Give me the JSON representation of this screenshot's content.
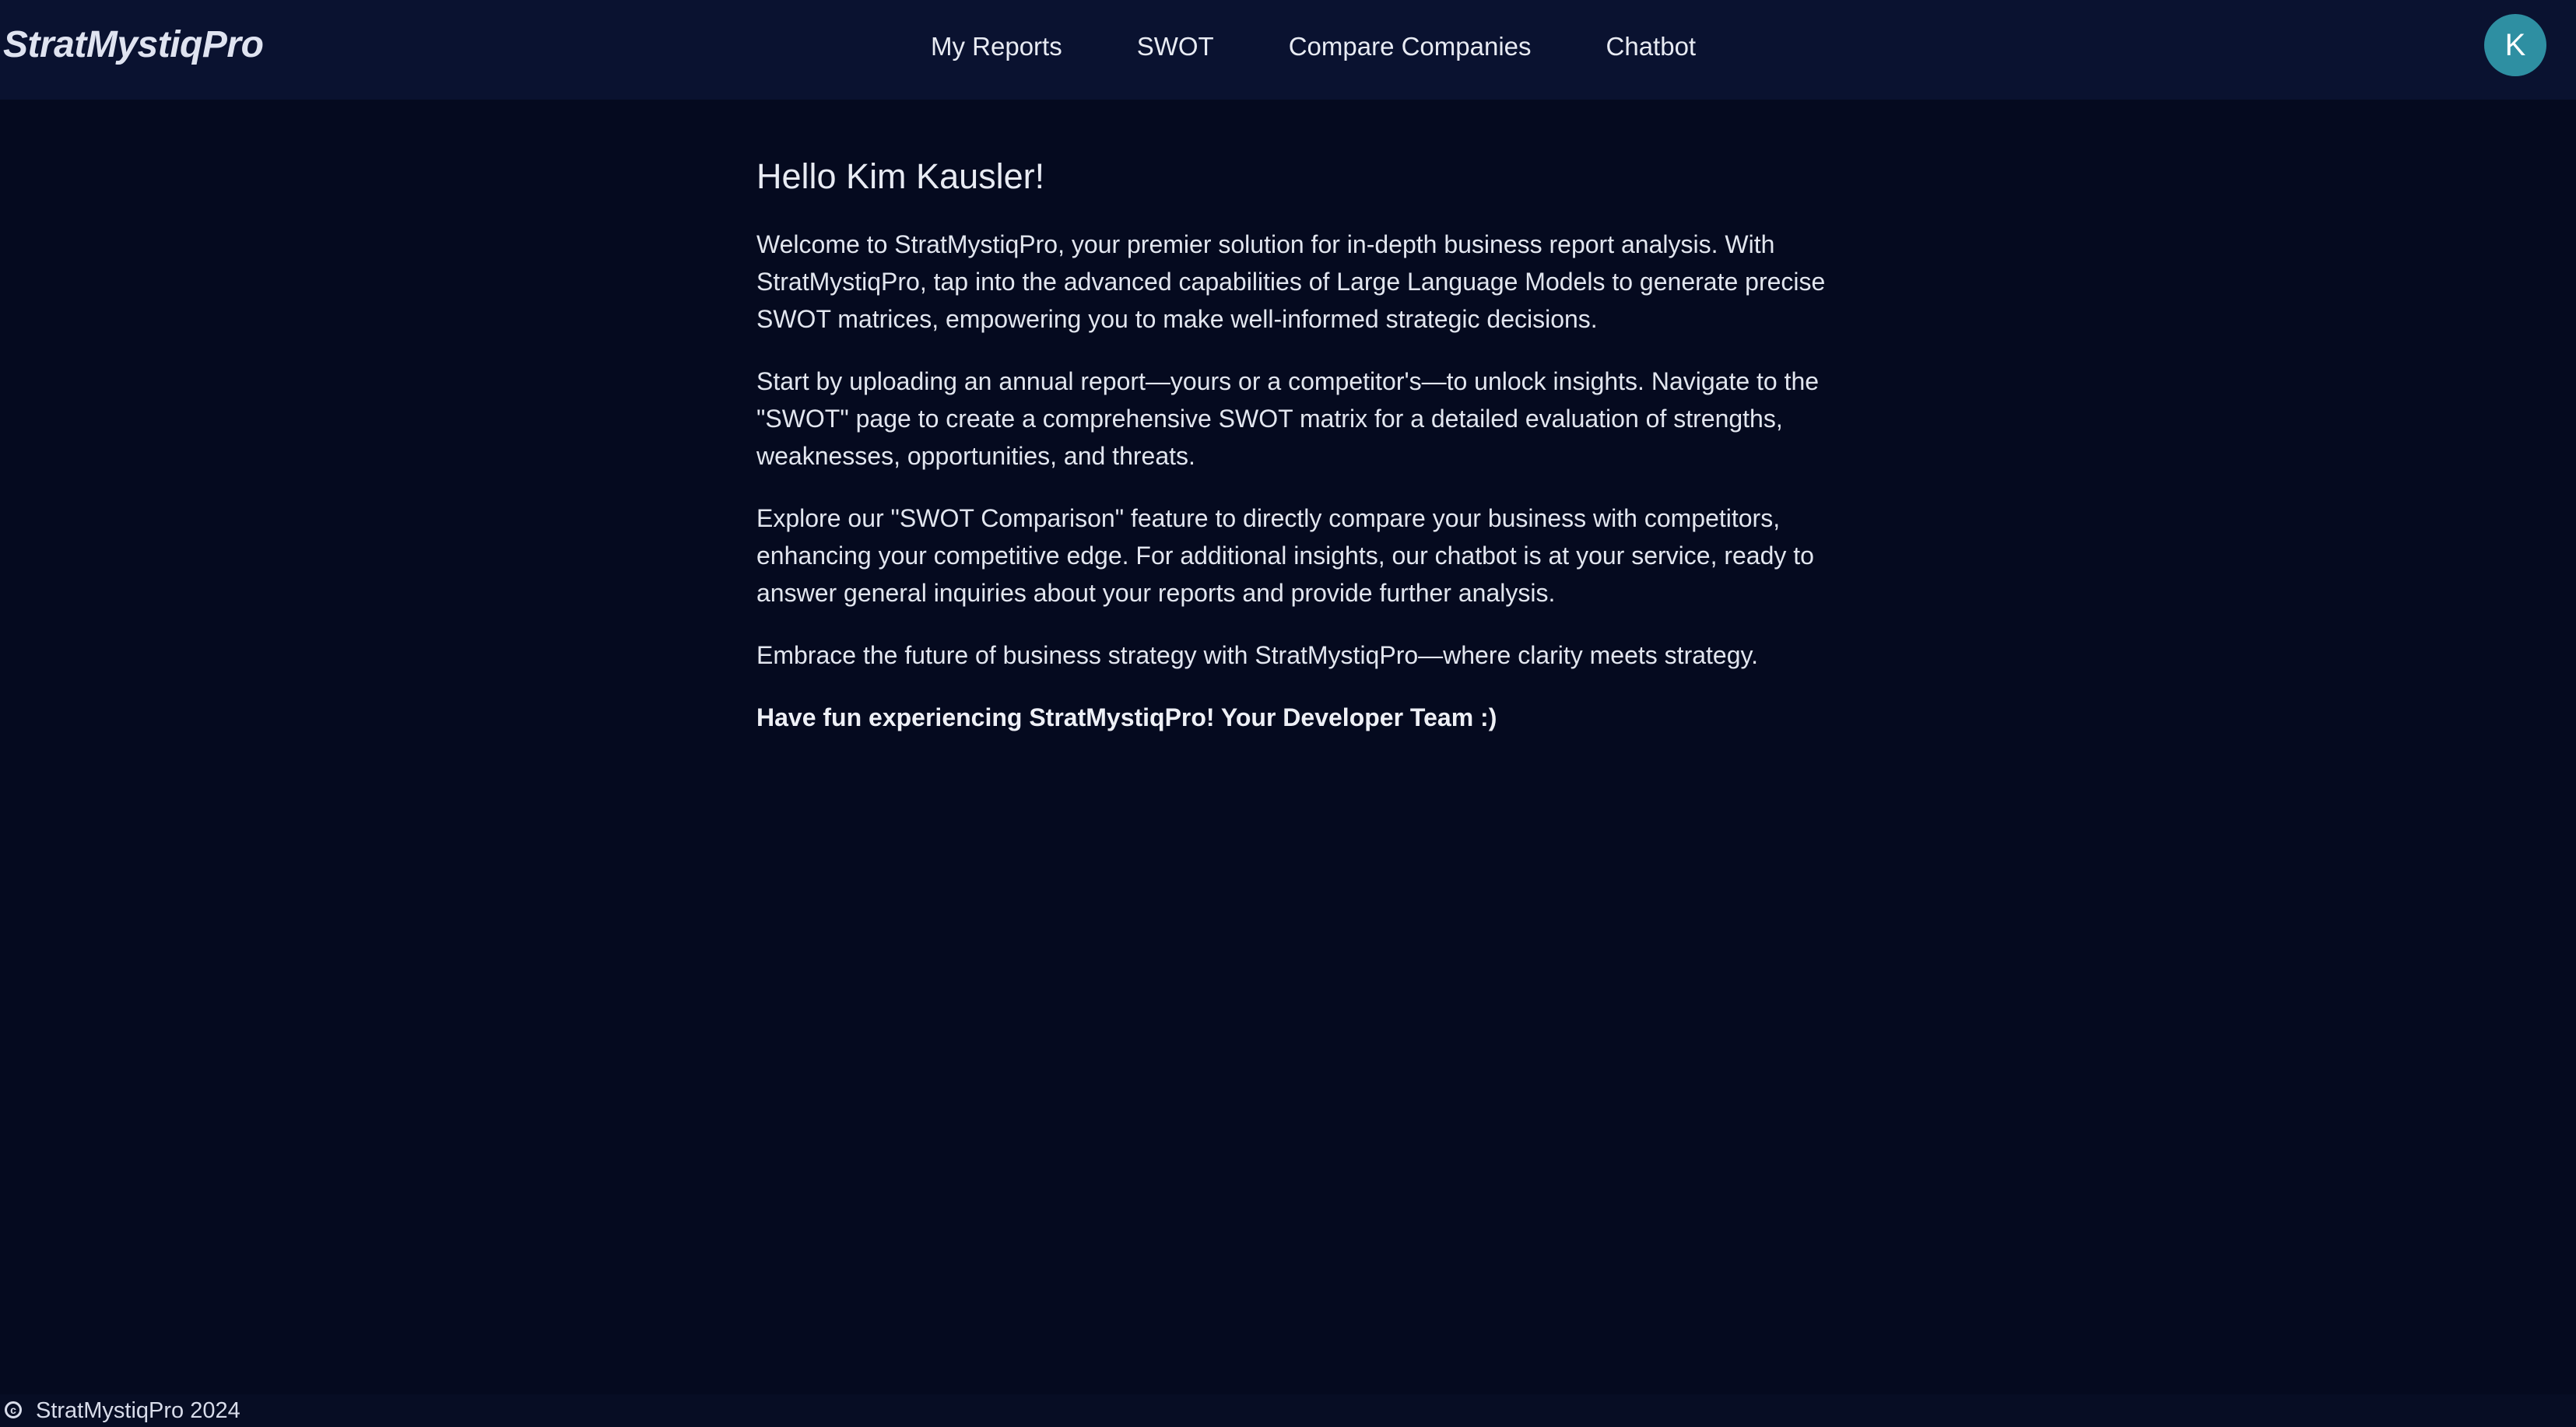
{
  "brand": "StratMystiqPro",
  "nav": {
    "items": [
      {
        "label": "My Reports"
      },
      {
        "label": "SWOT"
      },
      {
        "label": "Compare Companies"
      },
      {
        "label": "Chatbot"
      }
    ]
  },
  "user": {
    "avatar_initial": "K"
  },
  "main": {
    "greeting": "Hello Kim Kausler!",
    "paragraphs": [
      "Welcome to StratMystiqPro, your premier solution for in-depth business report analysis. With StratMystiqPro, tap into the advanced capabilities of Large Language Models to generate precise SWOT matrices, empowering you to make well-informed strategic decisions.",
      "Start by uploading an annual report—yours or a competitor's—to unlock insights. Navigate to the \"SWOT\" page to create a comprehensive SWOT matrix for a detailed evaluation of strengths, weaknesses, opportunities, and threats.",
      "Explore our \"SWOT Comparison\" feature to directly compare your business with competitors, enhancing your competitive edge. For additional insights, our chatbot is at your service, ready to answer general inquiries about your reports and provide further analysis.",
      "Embrace the future of business strategy with StratMystiqPro—where clarity meets strategy."
    ],
    "closing": "Have fun experiencing StratMystiqPro! Your Developer Team :)"
  },
  "footer": {
    "icon": "copyright-icon",
    "text": "StratMystiqPro 2024"
  },
  "colors": {
    "background": "#050a1f",
    "navbar": "#0a1230",
    "avatar": "#2e8fa2",
    "text": "#e6e9f2"
  }
}
